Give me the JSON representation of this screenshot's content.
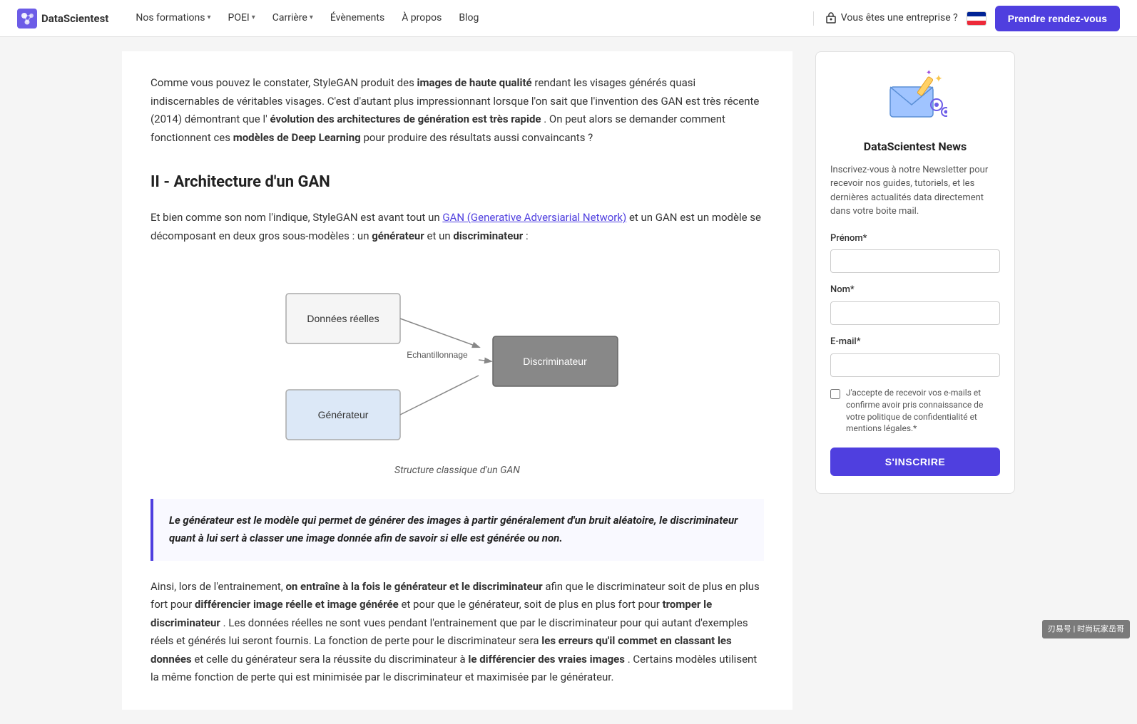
{
  "navbar": {
    "logo_text": "DataScientest",
    "formations_label": "Nos formations",
    "poei_label": "POEI",
    "carriere_label": "Carrière",
    "evenements_label": "Évènements",
    "apropos_label": "À propos",
    "blog_label": "Blog",
    "enterprise_label": "Vous êtes une entreprise ?",
    "cta_label": "Prendre rendez-vous"
  },
  "article": {
    "intro_p1_text": "Comme vous pouvez le constater, StyleGAN produit des ",
    "intro_bold1": "images de haute qualité",
    "intro_p1_cont": " rendant les visages générés quasi indiscernables de véritables visages. C'est d'autant plus impressionnant lorsque l'on sait que l'invention des GAN est très récente (2014) démontrant que l'",
    "intro_bold2": "évolution des architectures de génération est très rapide",
    "intro_p1_end": ". On peut alors se demander comment fonctionnent ces ",
    "intro_bold3": "modèles de Deep Learning",
    "intro_p1_final": " pour produire des résultats aussi convaincants ?",
    "section2_title": "II - Architecture d'un GAN",
    "section2_p1_pre": "Et bien comme son nom l'indique, StyleGAN est avant tout un ",
    "section2_link": "GAN (Generative Adversiarial Network)",
    "section2_p1_post": " et un GAN est un modèle se décomposant en deux gros sous-modèles : un ",
    "section2_bold1": "générateur",
    "section2_p1_mid": " et un ",
    "section2_bold2": "discriminateur",
    "section2_p1_end": " :",
    "diagram_label1": "Données réelles",
    "diagram_label2": "Echantillonnage",
    "diagram_label3": "Discriminateur",
    "diagram_label4": "Générateur",
    "diagram_caption": "Structure classique d'un GAN",
    "quote_text": "Le générateur est le modèle qui permet de générer des images à partir généralement d'un bruit aléatoire, le discriminateur quant à lui sert à classer une image donnée afin de savoir si elle est générée ou non.",
    "bottom_p1_pre": "Ainsi, lors de l'entrainement, ",
    "bottom_bold1": "on entraîne à la fois le générateur et le discriminateur",
    "bottom_p1_cont": " afin que le discriminateur soit de plus en plus fort pour ",
    "bottom_bold2": "différencier image réelle et image générée",
    "bottom_p1_mid": " et pour que le générateur, soit de plus en plus fort pour ",
    "bottom_bold3": "tromper le discriminateur",
    "bottom_p1_end": ". Les données réelles ne sont vues pendant l'entrainement que par le discriminateur pour qui autant d'exemples réels et générés lui seront fournis. La fonction de perte pour le discriminateur sera ",
    "bottom_bold4": "les erreurs qu'il commet en classant les données",
    "bottom_p1_mid2": " et celle du générateur sera la réussite du discriminateur à ",
    "bottom_bold5": "le différencier des vraies images",
    "bottom_p1_final": ". Certains modèles utilisent la même fonction de perte qui est minimisée par le discriminateur et maximisée par le générateur."
  },
  "newsletter": {
    "title": "DataScientest News",
    "description": "Inscrivez-vous à notre Newsletter pour recevoir nos guides, tutoriels, et les dernières actualités data directement dans votre boite mail.",
    "prenom_label": "Prénom*",
    "nom_label": "Nom*",
    "email_label": "E-mail*",
    "prenom_placeholder": "",
    "nom_placeholder": "",
    "email_placeholder": "",
    "checkbox_label": "J'accepte de recevoir vos e-mails et confirme avoir pris connaissance de votre politique de confidentialité et mentions légales.*",
    "subscribe_button": "S'INSCRIRE"
  },
  "watermark": "刃易号 | 时尚玩家岳哥"
}
